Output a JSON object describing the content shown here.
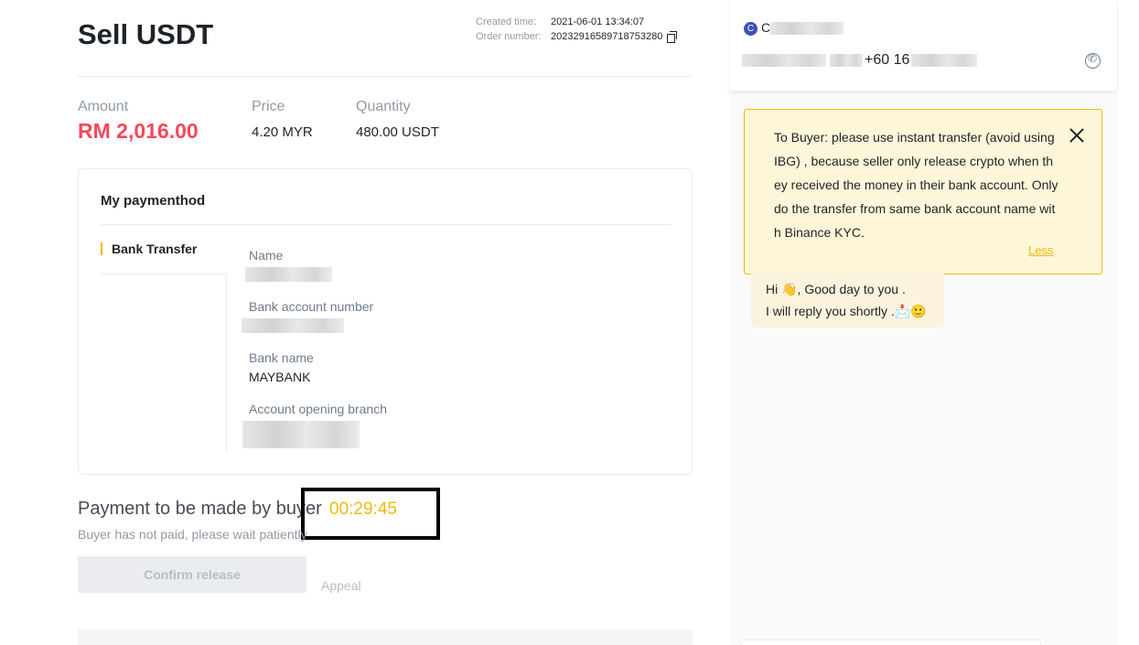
{
  "page": {
    "title": "Sell USDT"
  },
  "order": {
    "created_label": "Created time:",
    "created_value": "2021-06-01 13:34:07",
    "number_label": "Order number:",
    "number_value": "20232916589718753280"
  },
  "stats": {
    "amount_label": "Amount",
    "amount_value": "RM 2,016.00",
    "price_label": "Price",
    "price_value": "4.20 MYR",
    "quantity_label": "Quantity",
    "quantity_value": "480.00 USDT"
  },
  "payment": {
    "heading": "My paymenthod",
    "tab": "Bank Transfer",
    "fields": [
      {
        "label": "Name",
        "value": ""
      },
      {
        "label": "Bank account number",
        "value": ""
      },
      {
        "label": "Bank name",
        "value": "MAYBANK"
      },
      {
        "label": "Account opening branch",
        "value": ""
      }
    ]
  },
  "status": {
    "message": "Payment to be made by buyer",
    "timer": "00:29:45",
    "sub": "Buyer has not paid, please wait patiently",
    "confirm_label": "Confirm release",
    "appeal_label": "Appeal"
  },
  "chat": {
    "avatar_letter": "C",
    "name_visible": "C",
    "phone_visible": "+60 16",
    "notice": "To Buyer: please use instant transfer (avoid using IBG) , because seller only release crypto when they received the money in their bank account. Only do the transfer from same bank account name with Binance KYC.",
    "less_label": "Less",
    "greeting_line1": "Hi 👋,  Good day to you .",
    "greeting_line2": "I will reply you shortly .📩🙂"
  },
  "colors": {
    "accent": "#f0b90b",
    "amount": "#f6465d",
    "text": "#1e2329"
  }
}
